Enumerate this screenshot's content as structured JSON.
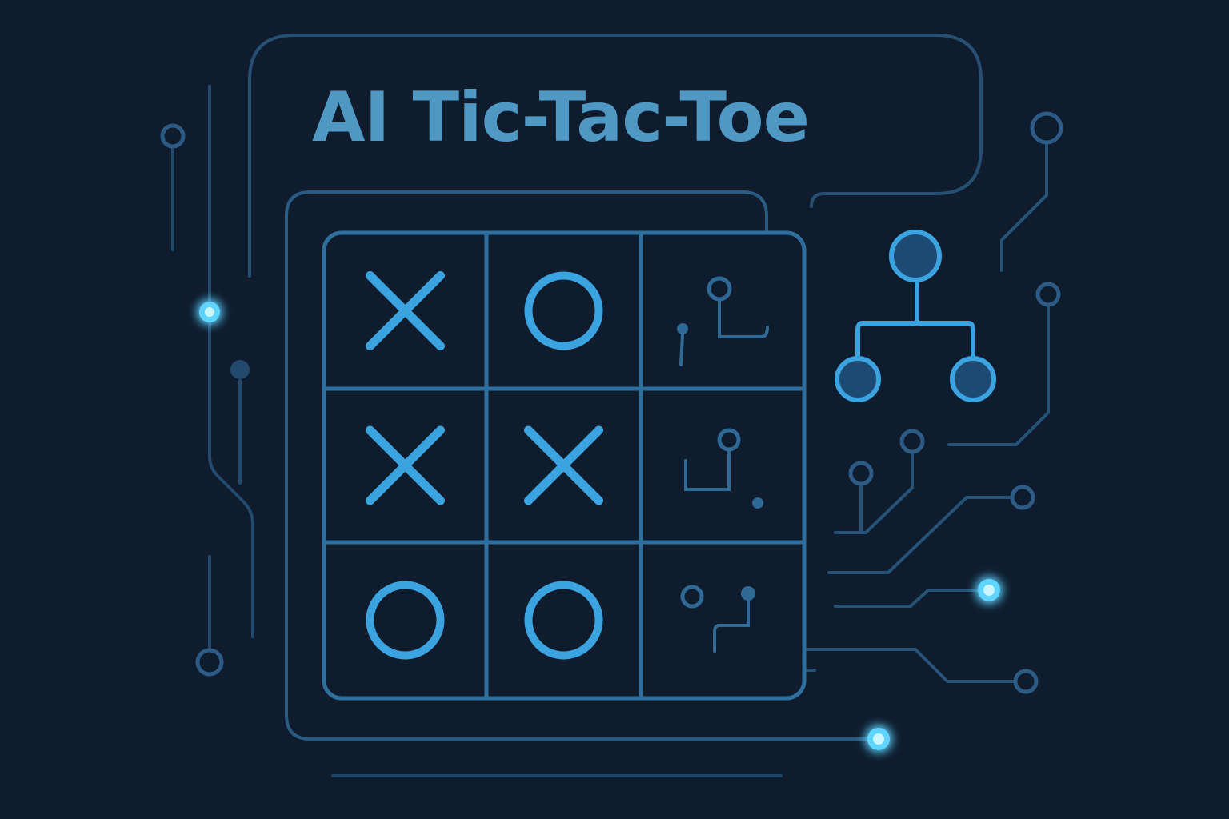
{
  "title": "AI Tic-Tac-Toe",
  "colors": {
    "background": "#0f1c2e",
    "accent": "#3ba3e0",
    "line": "#2e6a95",
    "glow": "#7fe6ff",
    "title": "#4f98c4"
  },
  "board": {
    "cells": [
      {
        "row": 0,
        "col": 0,
        "mark": "X"
      },
      {
        "row": 0,
        "col": 1,
        "mark": "O"
      },
      {
        "row": 0,
        "col": 2,
        "mark": "",
        "icon": "circuit-icon"
      },
      {
        "row": 1,
        "col": 0,
        "mark": "X"
      },
      {
        "row": 1,
        "col": 1,
        "mark": "X"
      },
      {
        "row": 1,
        "col": 2,
        "mark": "",
        "icon": "circuit-icon"
      },
      {
        "row": 2,
        "col": 0,
        "mark": "O"
      },
      {
        "row": 2,
        "col": 1,
        "mark": "O"
      },
      {
        "row": 2,
        "col": 2,
        "mark": "",
        "icon": "circuit-icon"
      }
    ]
  },
  "decor": {
    "tree_icon": "decision-tree-icon",
    "trace_icon": "circuit-trace-icon",
    "node_icon": "glowing-node-icon"
  }
}
